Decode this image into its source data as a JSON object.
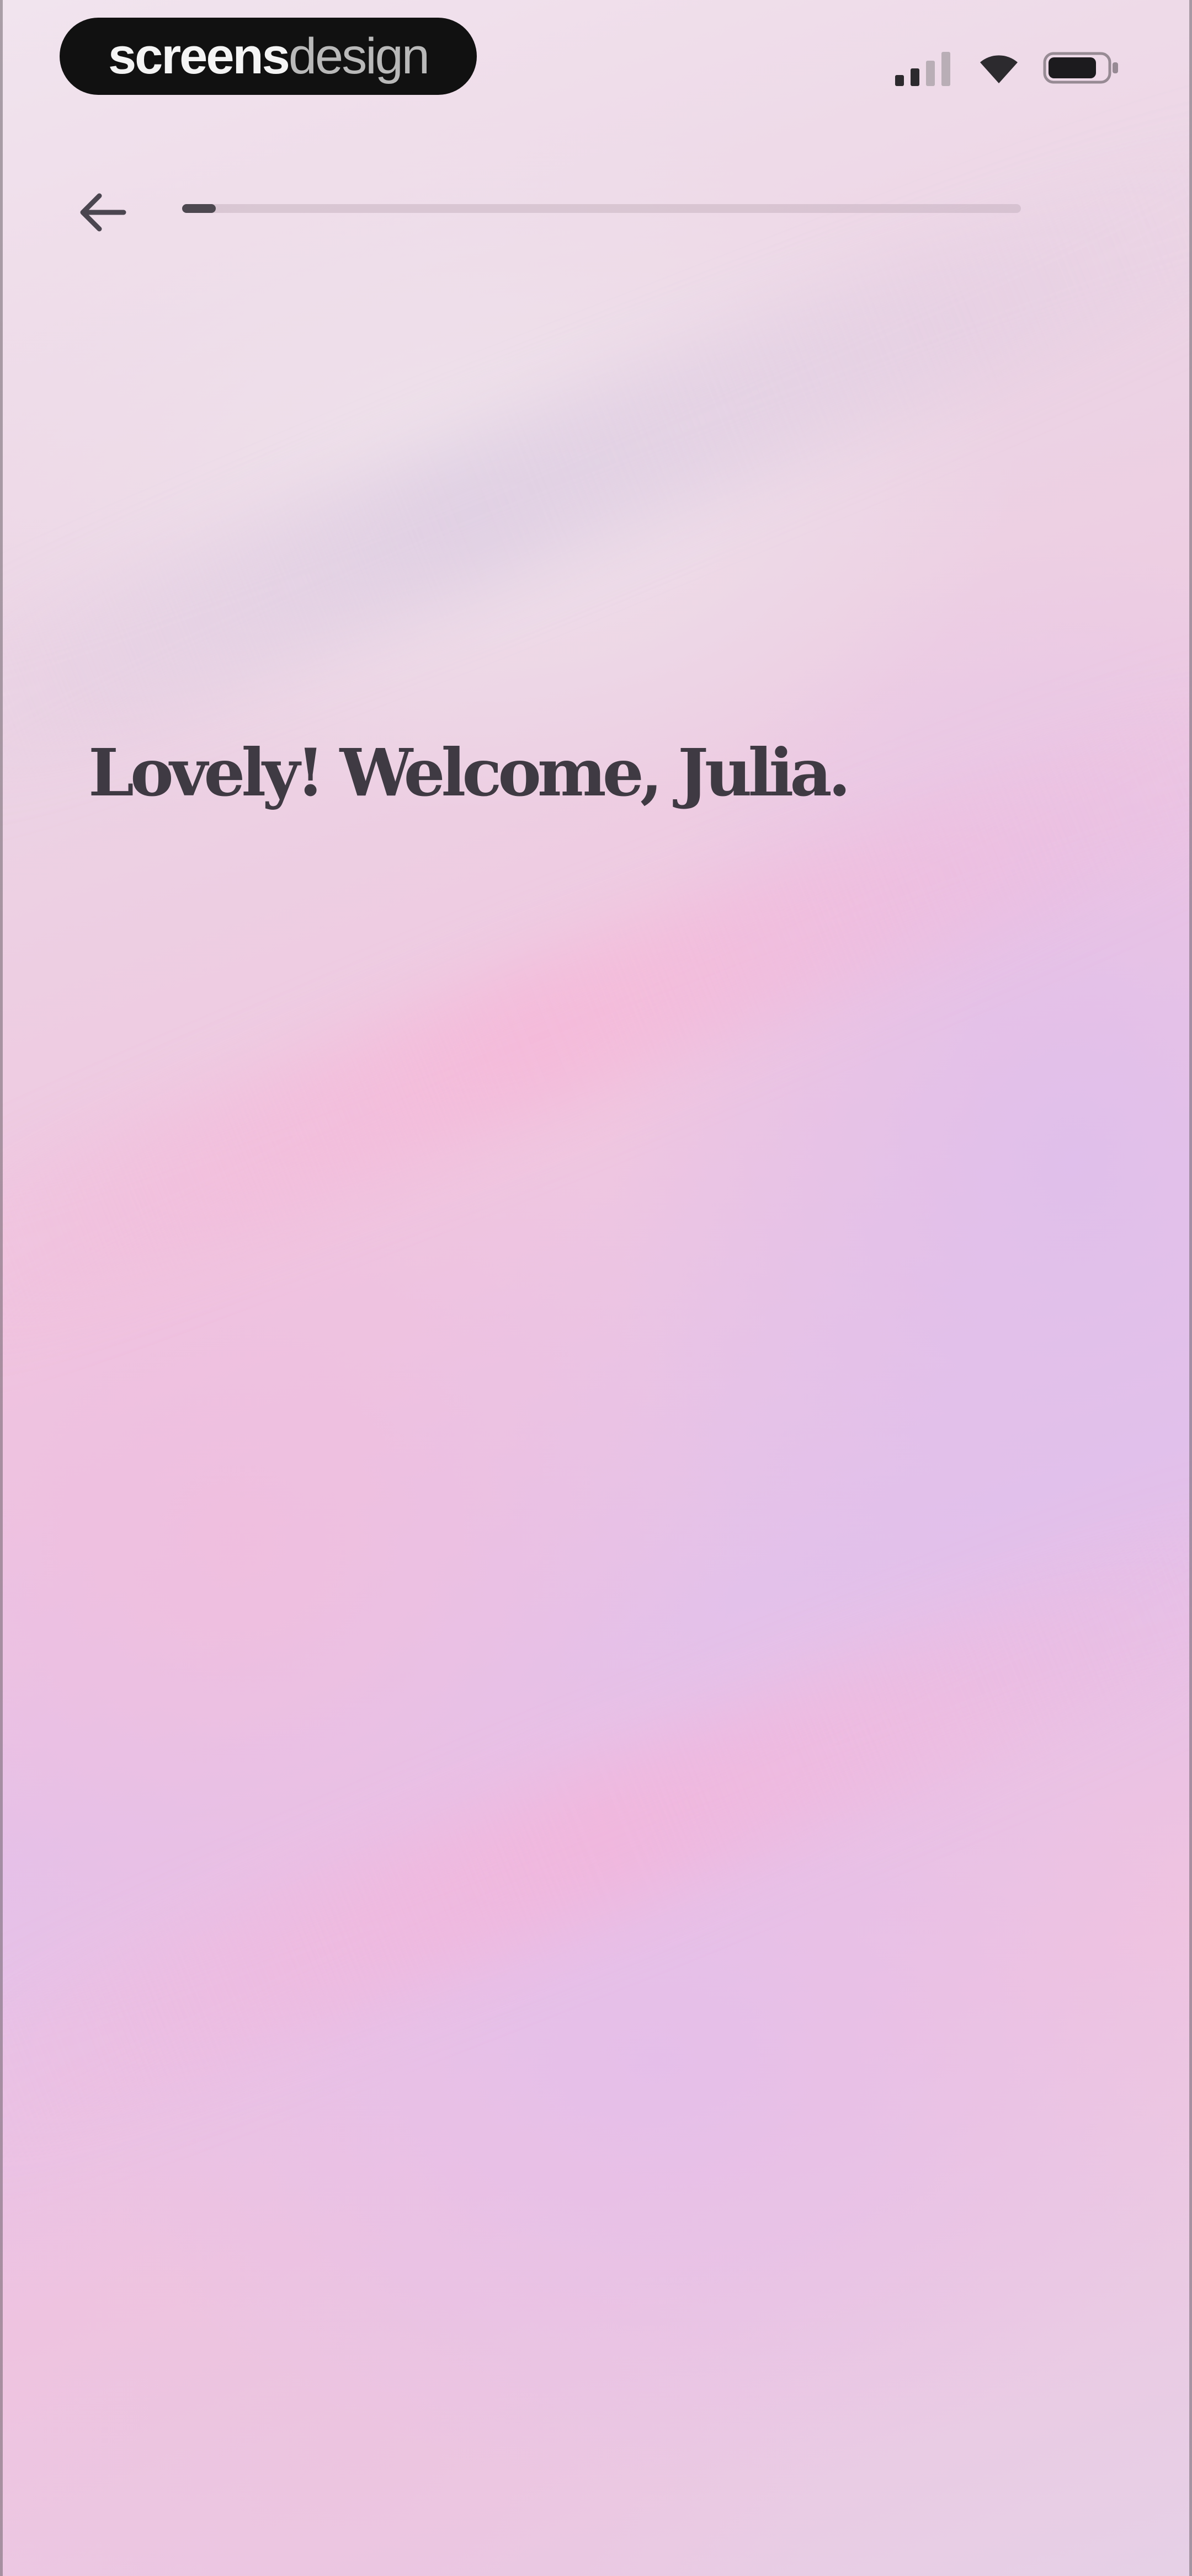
{
  "watermark": {
    "bold": "screens",
    "light": "design"
  },
  "status_bar": {
    "signal_icon": "cellular-signal-icon",
    "wifi_icon": "wifi-icon",
    "battery_icon": "battery-icon"
  },
  "nav": {
    "back_icon": "arrow-left-icon",
    "progress": 0.04
  },
  "main": {
    "heading": "Lovely! Welcome, Julia."
  },
  "colors": {
    "text": "#3f3a43",
    "progress_fill": "#4d4850",
    "progress_track": "#d9c8d6",
    "bg_pink": "#efc6e0",
    "bg_lilac": "#e3c1ea"
  }
}
